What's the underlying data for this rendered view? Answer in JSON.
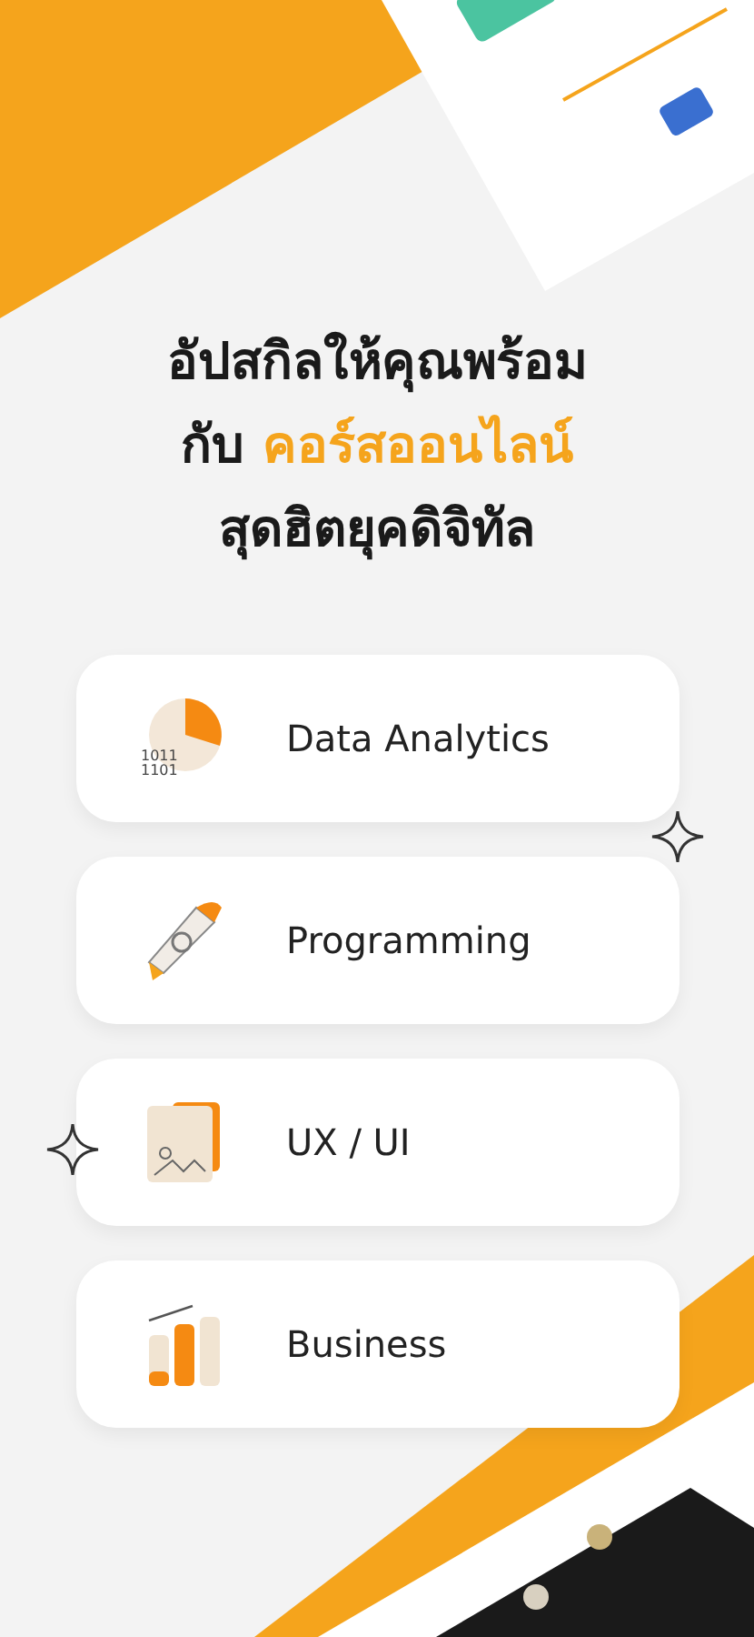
{
  "headline": {
    "lines": [
      [
        {
          "kind": "plain",
          "text": "อัปสกิลให้คุณพร้อม"
        }
      ],
      [
        {
          "kind": "plain",
          "text": "กับ "
        },
        {
          "kind": "accent",
          "text": "คอร์สออนไลน์"
        }
      ],
      [
        {
          "kind": "plain",
          "text": "สุดฮิตยุคดิจิทัล"
        }
      ]
    ]
  },
  "categories": [
    {
      "kind": "analytics",
      "label": "Data Analytics",
      "icon_text": [
        "1011",
        "1101"
      ]
    },
    {
      "kind": "programming",
      "label": "Programming"
    },
    {
      "kind": "design",
      "label": "UX / UI"
    },
    {
      "kind": "business",
      "label": "Business"
    }
  ]
}
